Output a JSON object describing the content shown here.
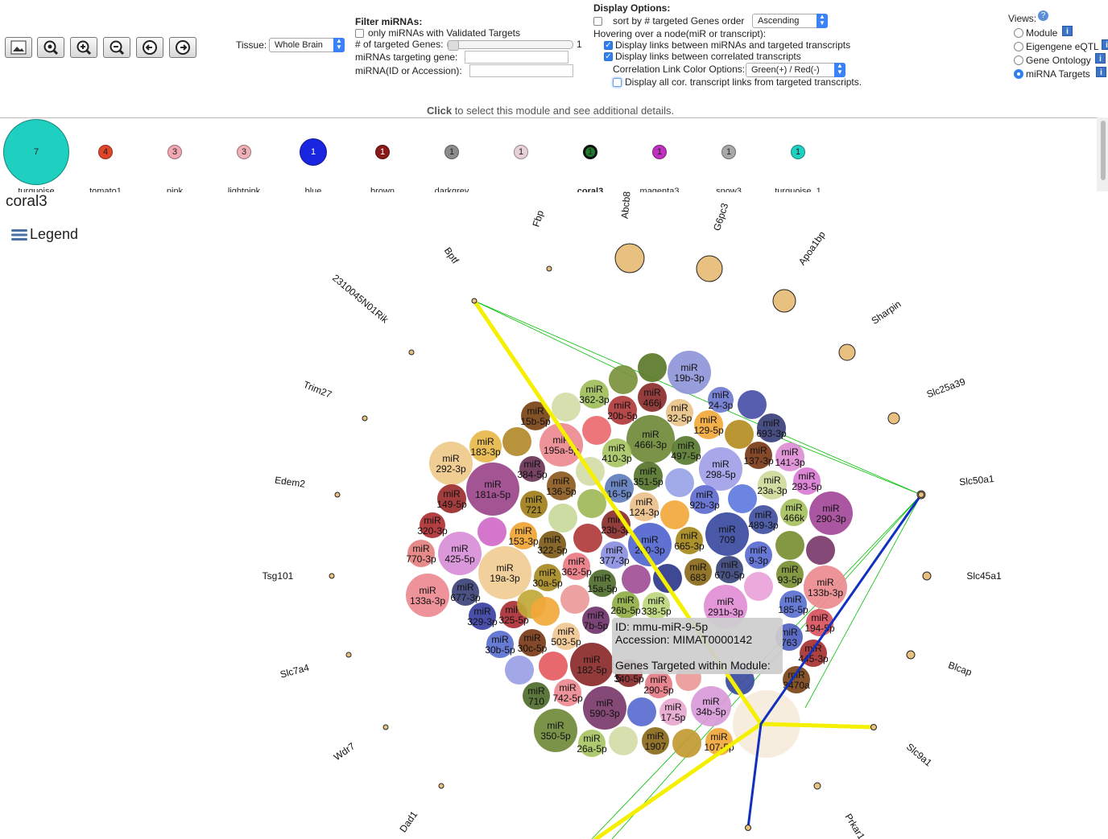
{
  "toolbar": {
    "icons": [
      "image-icon",
      "reset-zoom-icon",
      "zoom-in-icon",
      "zoom-out-icon",
      "rotate-left-icon",
      "rotate-right-icon"
    ]
  },
  "tissue": {
    "label": "Tissue:",
    "value": "Whole Brain"
  },
  "filter": {
    "title": "Filter miRNAs:",
    "validated_label": "only miRNAs with Validated Targets",
    "targeted_label": "# of targeted Genes:",
    "targeted_value": "1",
    "targeting_gene_label": "miRNAs targeting gene:",
    "mirna_id_label": "miRNA(ID or Accession):"
  },
  "display": {
    "title": "Display Options:",
    "sort_label": "sort by # targeted Genes order",
    "sort_value": "Ascending",
    "hover_label": "Hovering over a node(miR or transcript):",
    "links_mirna_label": "Display links between miRNAs and targeted transcripts",
    "links_corr_label": "Display links between correlated transcripts",
    "color_label": "Correlation Link Color Options:",
    "color_value": "Green(+) / Red(-)",
    "all_corr_label": "Display all cor. transcript links from targeted transcripts."
  },
  "views": {
    "title": "Views:",
    "options": [
      "Module",
      "Eigengene eQTL",
      "Gene Ontology",
      "miRNA Targets"
    ],
    "selected": "miRNA Targets"
  },
  "hint": {
    "bold": "Click",
    "rest": " to select this module and see additional details."
  },
  "modules": [
    {
      "count": "7",
      "label": "turquoise",
      "color": "#1fcfc0"
    },
    {
      "count": "4",
      "label": "tomato1",
      "color": "#e0452a"
    },
    {
      "count": "3",
      "label": "pink",
      "color": "#f2a8b2"
    },
    {
      "count": "3",
      "label": "lightpink",
      "color": "#f0b0b8"
    },
    {
      "count": "1",
      "label": "blue",
      "color": "#1a25e0"
    },
    {
      "count": "1",
      "label": "brown",
      "color": "#8a1a1a"
    },
    {
      "count": "1",
      "label": "darkgrey",
      "color": "#8c8c8c"
    },
    {
      "count": "1",
      "label": "",
      "color": "#e8d0d8"
    },
    {
      "count": "1",
      "label": "coral3",
      "color": "#1e7a2a"
    },
    {
      "count": "1",
      "label": "magenta3",
      "color": "#c030c0"
    },
    {
      "count": "1",
      "label": "snow3",
      "color": "#a8a8a8"
    },
    {
      "count": "1",
      "label": "turquoise_1",
      "color": "#20d0c0"
    }
  ],
  "selected_module": "coral3",
  "legend_label": "Legend",
  "genes": [
    "Fbp",
    "Abcb8",
    "G6pc3",
    "Apoa1bp",
    "Bptf",
    "2310045N01Rik",
    "Sharpin",
    "Slc25a39",
    "Trim27",
    "Edem2",
    "Slc50a1",
    "Tsg101",
    "Slc45a1",
    "Slc7a4",
    "Blcap",
    "Wdr7",
    "Slc9a1",
    "Dad1",
    "Prkar1"
  ],
  "mirnas": [
    "19b-3p",
    "466j",
    "362-3p",
    "20b-5p",
    "24-3p",
    "32-5p",
    "15b-5p",
    "195a-5p",
    "466l-3p",
    "129-5p",
    "693-3p",
    "183-3p",
    "292-3p",
    "410-3p",
    "497-5p",
    "137-3p",
    "141-3p",
    "384-5p",
    "181a-5p",
    "136-5p",
    "351-5p",
    "298-5p",
    "23a-3p",
    "293-5p",
    "149-5p",
    "721",
    "16-5p",
    "92b-3p",
    "489-3p",
    "290-3p",
    "466k",
    "320-3p",
    "124-3p",
    "23b-3p",
    "153-3p",
    "709",
    "665-3p",
    "322-5p",
    "425-5p",
    "377-3p",
    "200-3p",
    "9-3p",
    "770-3p",
    "19a-3p",
    "362-5p",
    "683",
    "670-5p",
    "93-5p",
    "133b-3p",
    "133a-3p",
    "677-3p",
    "30a-5p",
    "15a-5p",
    "26b-5p",
    "338-5p",
    "291b-3p",
    "185-5p",
    "329-3p",
    "325-5p",
    "7b-5p",
    "194-5p",
    "503-5p",
    "30b-5p",
    "763",
    "30c-5p",
    "445-3p",
    "182-5p",
    "340-5p",
    "290-5p",
    "3470a",
    "710",
    "742-5p",
    "17-5p",
    "34b-5p",
    "590-3p",
    "350-5p",
    "1907",
    "26a-5p",
    "107-5p"
  ],
  "tooltip": {
    "id_line": "ID: mmu-miR-9-5p",
    "accession_line": "Accession: MIMAT0000142",
    "targets_line": "Genes Targeted within Module: 5"
  },
  "colors": {
    "link_mirna": "#f5f000",
    "link_corr": "#00c000",
    "link_blue": "#1030c0",
    "gene_node": "#e8c080"
  }
}
